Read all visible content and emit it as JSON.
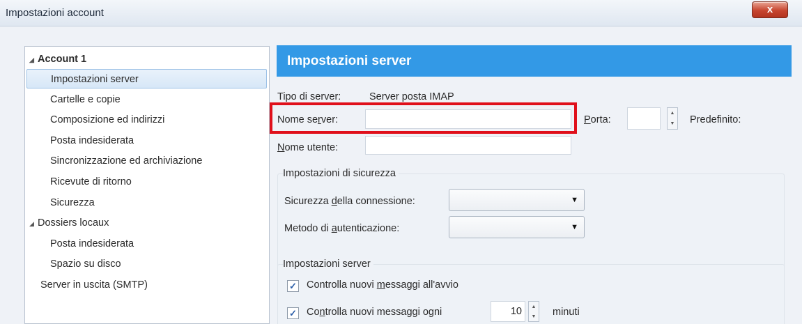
{
  "window": {
    "title": "Impostazioni account",
    "close_label": "x"
  },
  "tree": {
    "account": "Account 1",
    "account_items": [
      "Impostazioni server",
      "Cartelle e copie",
      "Composizione ed indirizzi",
      "Posta indesiderata",
      "Sincronizzazione ed archiviazione",
      "Ricevute di ritorno",
      "Sicurezza"
    ],
    "local": "Dossiers locaux",
    "local_items": [
      "Posta indesiderata",
      "Spazio su disco"
    ],
    "smtp": "Server in uscita (SMTP)",
    "selected": "Impostazioni server"
  },
  "panel": {
    "header": "Impostazioni server",
    "server_type_label": "Tipo di server:",
    "server_type_value": "Server posta IMAP",
    "server_name_label_pre": "Nome se",
    "server_name_label_u": "r",
    "server_name_label_post": "ver:",
    "server_name_value": "",
    "port_label_u": "P",
    "port_label_post": "orta:",
    "port_value": "",
    "default_label": "Predefinito:",
    "user_label_u": "N",
    "user_label_post": "ome utente:",
    "user_value": ""
  },
  "security": {
    "title": "Impostazioni di sicurezza",
    "conn_label_pre": "Sicurezza ",
    "conn_label_u": "d",
    "conn_label_post": "ella connessione:",
    "conn_value": "",
    "auth_label_pre": "Metodo di ",
    "auth_label_u": "a",
    "auth_label_post": "utenticazione:",
    "auth_value": ""
  },
  "server_settings": {
    "title": "Impostazioni server",
    "check1_pre": "Controlla nuovi ",
    "check1_u": "m",
    "check1_post": "essaggi all'avvio",
    "check1_checked": true,
    "check2_pre": "Co",
    "check2_u": "n",
    "check2_post": "trolla nuovi messaggi ogni",
    "check2_checked": true,
    "interval_value": "10",
    "interval_unit": "minuti"
  },
  "icons": {
    "expand": "expand-triangle-icon",
    "dropdown": "dropdown-arrow-icon",
    "check": "checkmark-icon"
  }
}
